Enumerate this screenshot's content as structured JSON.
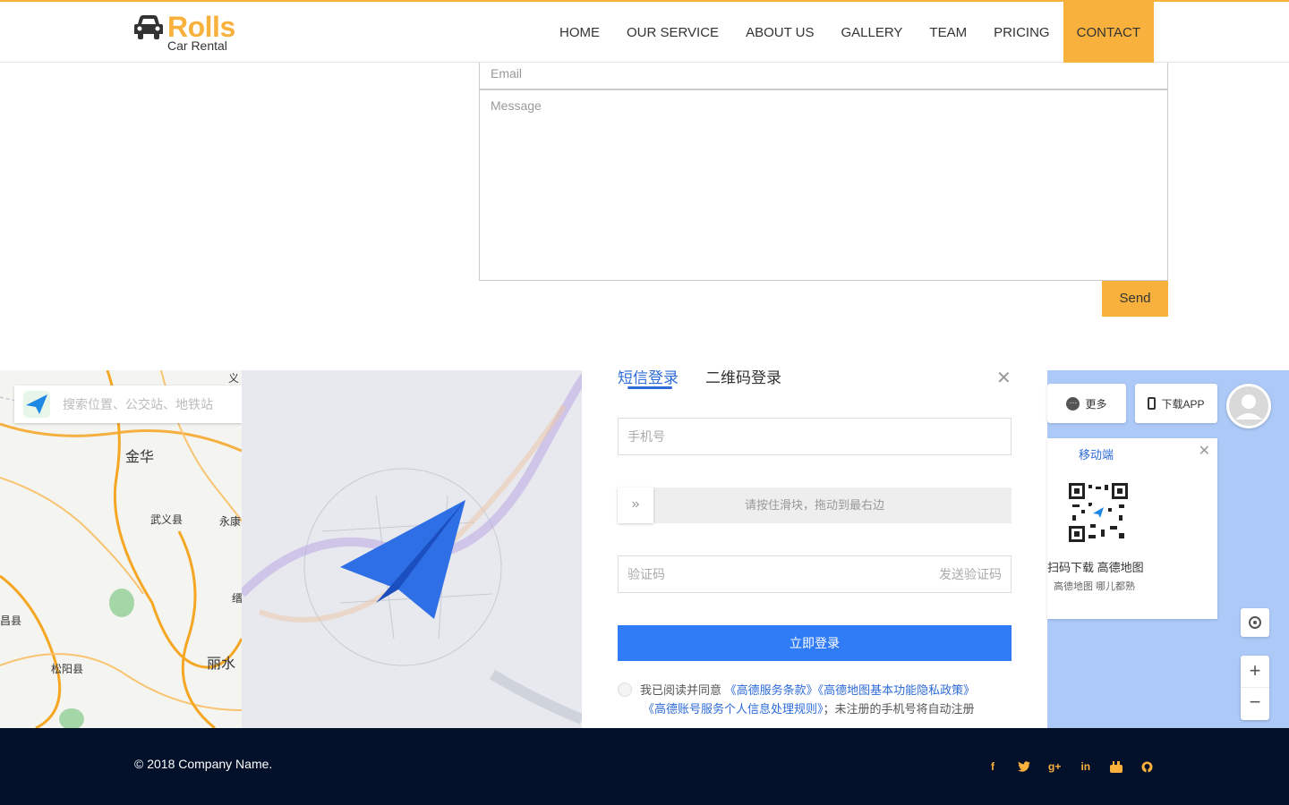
{
  "brand": {
    "name": "Rolls",
    "subtitle": "Car Rental",
    "accent": "#f8b13c"
  },
  "nav": {
    "items": [
      {
        "label": "HOME"
      },
      {
        "label": "OUR SERVICE"
      },
      {
        "label": "ABOUT US"
      },
      {
        "label": "GALLERY"
      },
      {
        "label": "TEAM"
      },
      {
        "label": "PRICING"
      },
      {
        "label": "CONTACT",
        "active": true
      }
    ]
  },
  "contact_form": {
    "email_placeholder": "Email",
    "message_placeholder": "Message",
    "send_label": "Send"
  },
  "map": {
    "search_placeholder": "搜索位置、公交站、地铁站",
    "cities": [
      "金华",
      "武义县",
      "永康",
      "丽水",
      "松阳县",
      "缙",
      "昌县",
      "义"
    ],
    "more_label": "更多",
    "download_label": "下载APP",
    "qr": {
      "title": "移动端",
      "line1": "扫码下载 高德地图",
      "line2": "高德地图 哪儿都熟"
    }
  },
  "login": {
    "tab_sms": "短信登录",
    "tab_qr": "二维码登录",
    "phone_placeholder": "手机号",
    "slider_text": "请按住滑块，拖动到最右边",
    "code_placeholder": "验证码",
    "send_code": "发送验证码",
    "submit": "立即登录",
    "agree_prefix": "我已阅读并同意",
    "link1": "《高德服务条款》",
    "link2": "《高德地图基本功能隐私政策》",
    "link3": "《高德账号服务个人信息处理规则》",
    "agree_suffix": "；未注册的手机号将自动注册",
    "color": "#2f7cf6"
  },
  "footer": {
    "copyright": "© 2018 Company Name.",
    "socials": [
      "facebook-icon",
      "twitter-icon",
      "google-plus-icon",
      "linkedin-icon",
      "youtube-icon",
      "github-icon"
    ]
  }
}
